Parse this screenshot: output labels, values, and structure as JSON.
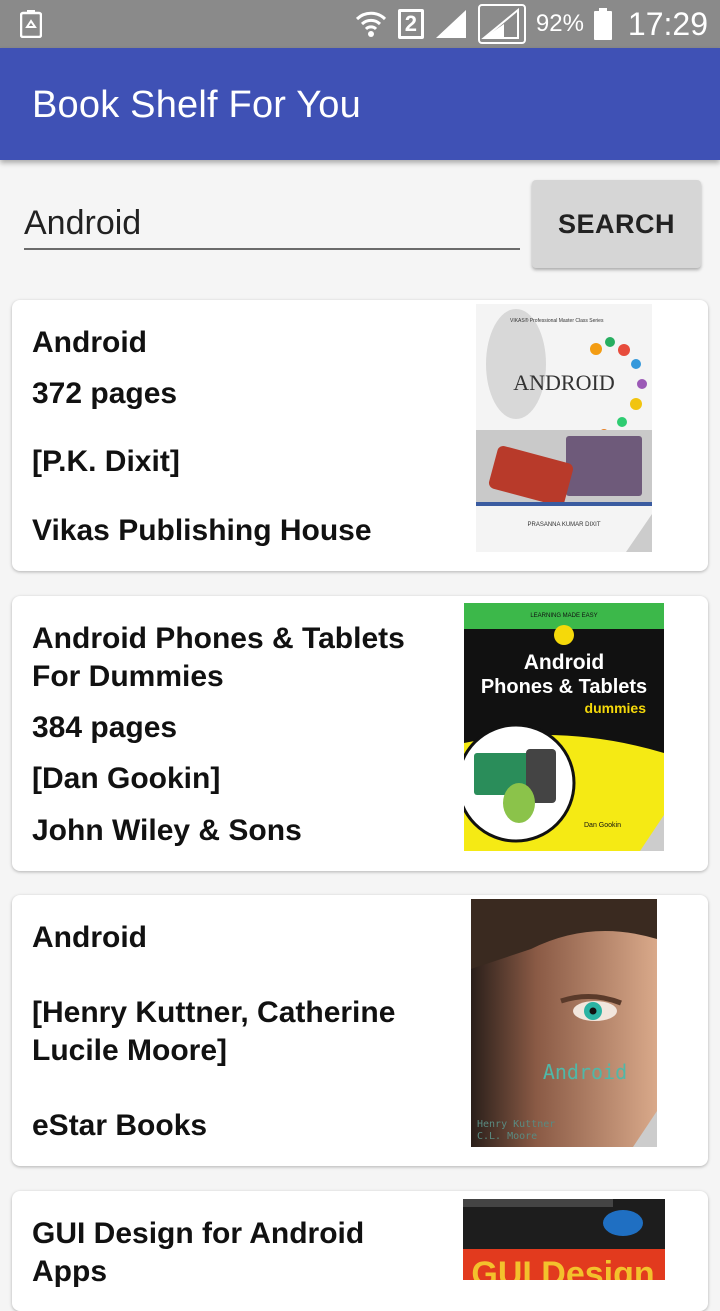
{
  "status_bar": {
    "battery_percent": "92%",
    "time": "17:29",
    "sim_slot": "2"
  },
  "app_bar": {
    "title": "Book Shelf For You"
  },
  "search": {
    "query": "Android",
    "button_label": "SEARCH"
  },
  "books": [
    {
      "title": "Android",
      "pages": "372 pages",
      "authors": "[P.K. Dixit]",
      "publisher": "Vikas Publishing House",
      "cover": {
        "series": "VIKAS® Professional Master Class Series",
        "title": "ANDROID",
        "author": "PRASANNA KUMAR DIXIT"
      }
    },
    {
      "title": "Android Phones & Tablets For Dummies",
      "pages": "384 pages",
      "authors": "[Dan Gookin]",
      "publisher": "John Wiley & Sons",
      "cover": {
        "banner": "LEARNING MADE EASY",
        "title_line1": "Android",
        "title_line2": "Phones & Tablets",
        "brand": "dummies",
        "author": "Dan Gookin"
      }
    },
    {
      "title": "Android",
      "pages": "",
      "authors": "[Henry Kuttner, Catherine Lucile Moore]",
      "publisher": "eStar Books",
      "cover": {
        "title": "Android",
        "author_line1": "Henry Kuttner",
        "author_line2": "C.L. Moore"
      }
    },
    {
      "title": "GUI Design for Android Apps",
      "cover": {
        "title": "GUI Design"
      }
    }
  ]
}
